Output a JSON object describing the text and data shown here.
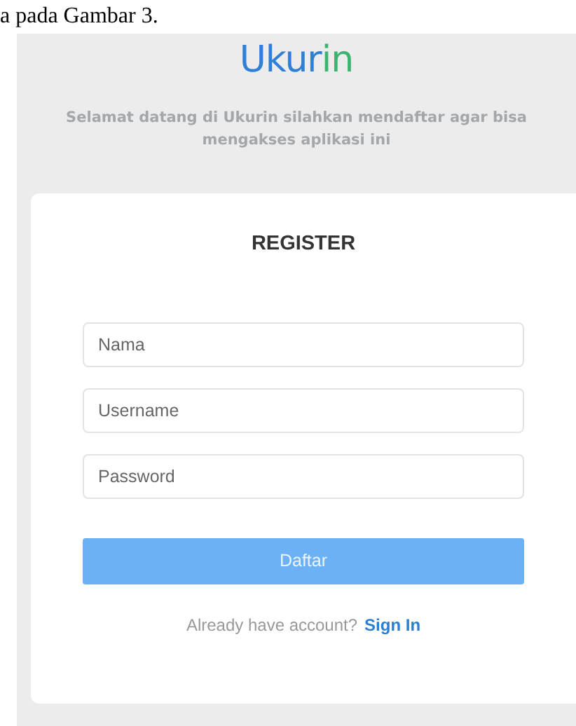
{
  "document_text": "a pada Gambar 3.",
  "logo": [
    {
      "text": "Ukur",
      "color": "#2f7fd6"
    },
    {
      "text": "in",
      "color": "#3cb371"
    }
  ],
  "subtitle": "Selamat datang di Ukurin silahkan mendaftar agar bisa mengakses aplikasi ini",
  "form": {
    "title": "REGISTER",
    "fields": [
      {
        "placeholder": "Nama"
      },
      {
        "placeholder": "Username"
      },
      {
        "placeholder": "Password"
      }
    ],
    "submit": "Daftar",
    "footer": {
      "text": "Already have account?",
      "link": "Sign In"
    }
  }
}
